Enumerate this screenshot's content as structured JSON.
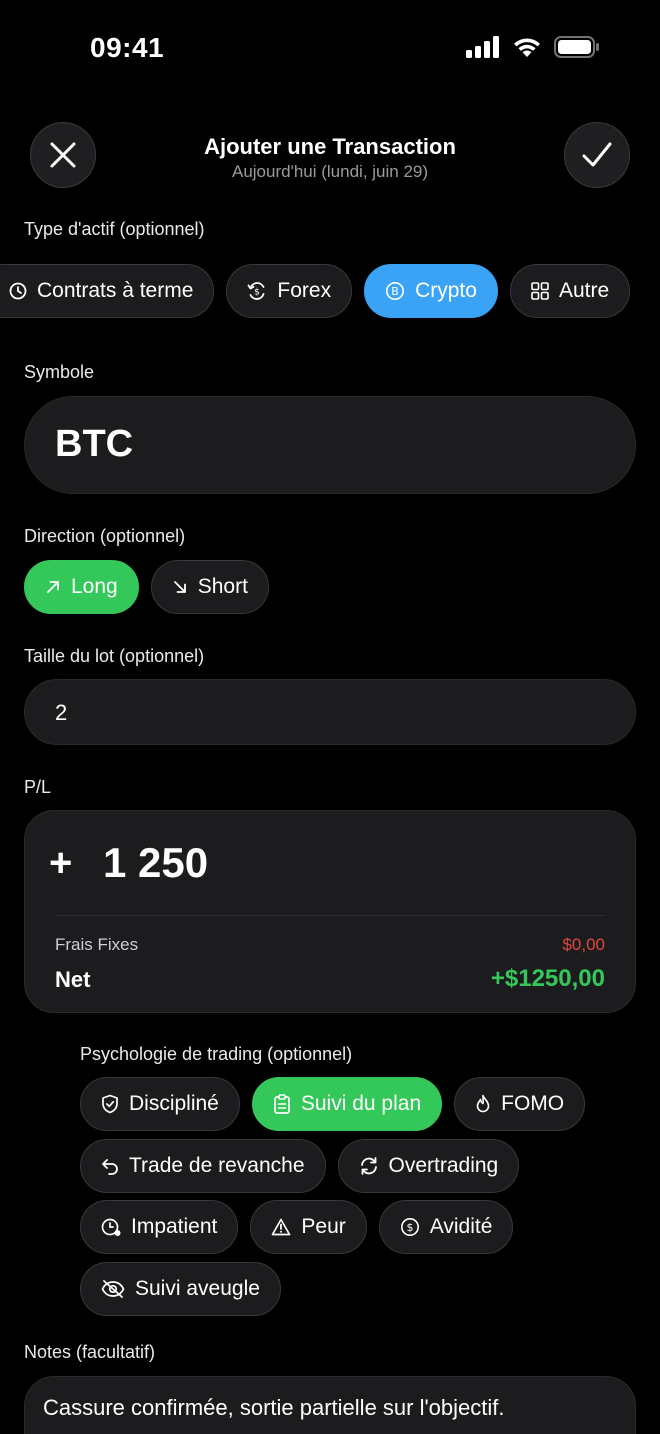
{
  "status": {
    "time": "09:41"
  },
  "header": {
    "title": "Ajouter une Transaction",
    "subtitle": "Aujourd'hui (lundi, juin 29)",
    "close_icon": "close-icon",
    "confirm_icon": "checkmark-icon"
  },
  "asset_type": {
    "label": "Type d'actif (optionnel)",
    "options": [
      {
        "label": "Contrats à terme",
        "icon": "clock-icon"
      },
      {
        "label": "Forex",
        "icon": "currency-exchange-icon"
      },
      {
        "label": "Crypto",
        "icon": "bitcoin-icon"
      },
      {
        "label": "Autre",
        "icon": "grid-icon"
      }
    ],
    "selected": "Crypto"
  },
  "symbol": {
    "label": "Symbole",
    "value": "BTC"
  },
  "direction": {
    "label": "Direction (optionnel)",
    "options": [
      {
        "label": "Long",
        "icon": "arrow-up-right-icon"
      },
      {
        "label": "Short",
        "icon": "arrow-down-right-icon"
      }
    ],
    "selected": "Long"
  },
  "lot_size": {
    "label": "Taille du lot (optionnel)",
    "value": "2"
  },
  "pl": {
    "label": "P/L",
    "sign": "+",
    "value": "1 250",
    "fees_label": "Frais Fixes",
    "fees_value": "$0,00",
    "net_label": "Net",
    "net_value": "+$1250,00"
  },
  "psychology": {
    "label": "Psychologie de trading (optionnel)",
    "options": [
      {
        "label": "Discipliné",
        "icon": "shield-check-icon"
      },
      {
        "label": "Suivi du plan",
        "icon": "clipboard-icon"
      },
      {
        "label": "FOMO",
        "icon": "flame-icon"
      },
      {
        "label": "Trade de revanche",
        "icon": "undo-arrow-icon"
      },
      {
        "label": "Overtrading",
        "icon": "refresh-icon"
      },
      {
        "label": "Impatient",
        "icon": "timer-icon"
      },
      {
        "label": "Peur",
        "icon": "warning-icon"
      },
      {
        "label": "Avidité",
        "icon": "dollar-circle-icon"
      },
      {
        "label": "Suivi aveugle",
        "icon": "eye-off-icon"
      }
    ],
    "selected": "Suivi du plan"
  },
  "notes": {
    "label": "Notes (facultatif)",
    "value": "Cassure confirmée, sortie partielle sur l'objectif."
  },
  "colors": {
    "background": "#000000",
    "surface": "#1c1c1e",
    "accent_blue": "#3aa3f5",
    "accent_green": "#34c85a",
    "negative_red": "#e0473c"
  }
}
